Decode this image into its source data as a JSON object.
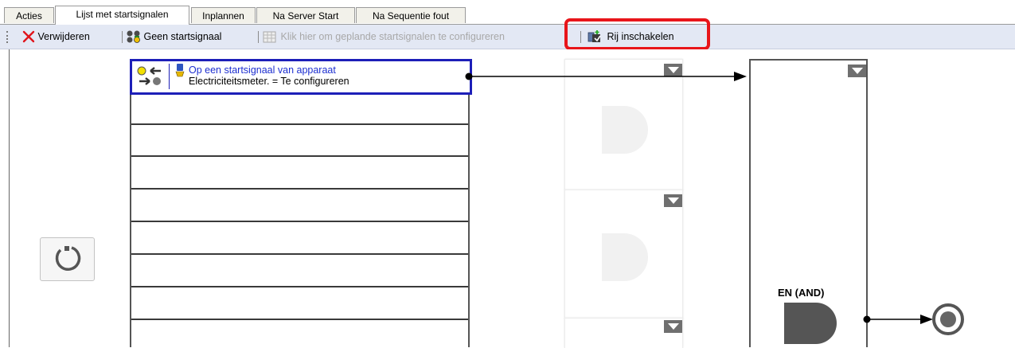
{
  "tabs": [
    "Acties",
    "Lijst met startsignalen",
    "Inplannen",
    "Na Server Start",
    "Na Sequentie fout"
  ],
  "active_tab": "Lijst met startsignalen",
  "toolbar": {
    "delete_label": "Verwijderen",
    "no_start_label": "Geen startsignaal",
    "schedule_label": "Klik hier om geplande startsignalen te configureren",
    "enable_row_label": "Rij inschakelen"
  },
  "list": {
    "first_row": {
      "title": "Op een startsignaal van apparaat",
      "subtitle": "Electriciteitsmeter. = Te configureren"
    }
  },
  "and_gate": {
    "label": "EN (AND)"
  },
  "icons": {
    "delete": "red-x-icon",
    "no_start": "no-start-signal-icon",
    "schedule": "calendar-grid-icon",
    "enable_row": "enable-row-icon",
    "refresh": "refresh-icon",
    "device": "device-icon",
    "end": "end-node-icon"
  },
  "colors": {
    "highlight": "#e8151a",
    "selected_row_border": "#1d1fb8",
    "link_text": "#1d2fd0",
    "toolbar_bg": "#e3e8f4"
  }
}
